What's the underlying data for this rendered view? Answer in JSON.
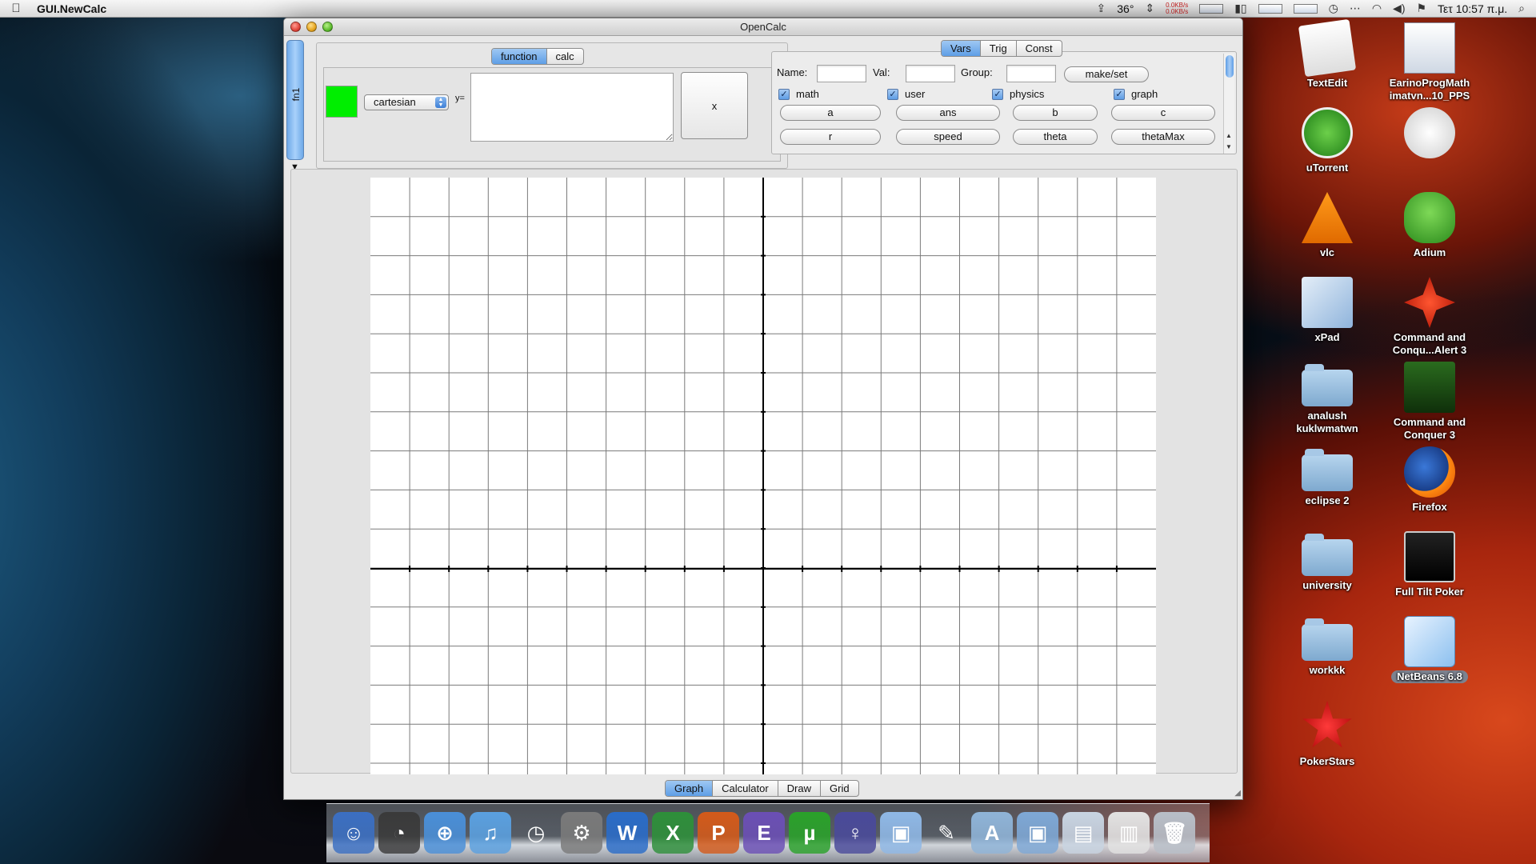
{
  "menubar": {
    "apple_icon": "apple-logo-icon",
    "app_name": "GUI.NewCalc",
    "temperature": "36°",
    "net_up": "0.0KB/s",
    "net_down": "0.0KB/s",
    "clock": "Τετ 10:57 π.μ."
  },
  "window": {
    "title": "OpenCalc",
    "side_tab_label": "fn1",
    "function_panel": {
      "tabs": [
        "function",
        "calc"
      ],
      "selected_tab": "function",
      "swatch_color": "#00ee00",
      "coordinate_mode": "cartesian",
      "y_label": "y=",
      "y_input_value": "",
      "x_button_label": "x"
    },
    "vars_panel": {
      "tabs": [
        "Vars",
        "Trig",
        "Const"
      ],
      "selected_tab": "Vars",
      "name_label": "Name:",
      "val_label": "Val:",
      "group_label": "Group:",
      "name_value": "",
      "val_value": "",
      "group_value": "",
      "make_set_label": "make/set",
      "checks": [
        {
          "label": "math",
          "checked": true
        },
        {
          "label": "user",
          "checked": true
        },
        {
          "label": "physics",
          "checked": true
        },
        {
          "label": "graph",
          "checked": true
        }
      ],
      "var_buttons": [
        "a",
        "ans",
        "b",
        "c",
        "r",
        "speed",
        "theta",
        "thetaMax"
      ]
    },
    "graph": {
      "grid_columns": 20,
      "grid_rows": 15,
      "axis_color": "#000000",
      "grid_color": "#7a7a7a"
    },
    "bottom_tabs": [
      "Graph",
      "Calculator",
      "Draw",
      "Grid"
    ],
    "selected_bottom_tab": "Graph"
  },
  "desktop_icons": [
    {
      "label": "TextEdit",
      "icon": "textedit-icon"
    },
    {
      "label": "EarinoProgMath imatvn...10_PPS",
      "icon": "document-icon"
    },
    {
      "label": "uTorrent",
      "icon": "utorrent-icon"
    },
    {
      "label": "",
      "icon": "pes2010-icon"
    },
    {
      "label": "vlc",
      "icon": "vlc-icon"
    },
    {
      "label": "Adium",
      "icon": "adium-icon"
    },
    {
      "label": "xPad",
      "icon": "xpad-icon"
    },
    {
      "label": "Command and Conqu...Alert 3",
      "icon": "red-alert-icon"
    },
    {
      "label": "analush kuklwmatwn",
      "icon": "folder-icon"
    },
    {
      "label": "Command and Conquer 3",
      "icon": "cnc-icon"
    },
    {
      "label": "eclipse 2",
      "icon": "folder-icon"
    },
    {
      "label": "Firefox",
      "icon": "firefox-icon"
    },
    {
      "label": "university",
      "icon": "folder-icon"
    },
    {
      "label": "Full Tilt Poker",
      "icon": "fulltilt-icon"
    },
    {
      "label": "workkk",
      "icon": "folder-icon"
    },
    {
      "label": "NetBeans 6.8",
      "icon": "netbeans-icon"
    },
    {
      "label": "PokerStars",
      "icon": "pokerstars-icon"
    }
  ],
  "dock_items": [
    "finder-icon",
    "dashboard-icon",
    "safari-icon",
    "itunes-icon",
    "time-machine-icon",
    "system-preferences-icon",
    "word-icon",
    "excel-icon",
    "powerpoint-icon",
    "entourage-icon",
    "utorrent-icon",
    "adium-icon",
    "netbeans-icon",
    "textedit-icon",
    "applications-folder-icon",
    "netbeans-folder-icon",
    "preview-icon",
    "document-icon",
    "trash-icon"
  ]
}
